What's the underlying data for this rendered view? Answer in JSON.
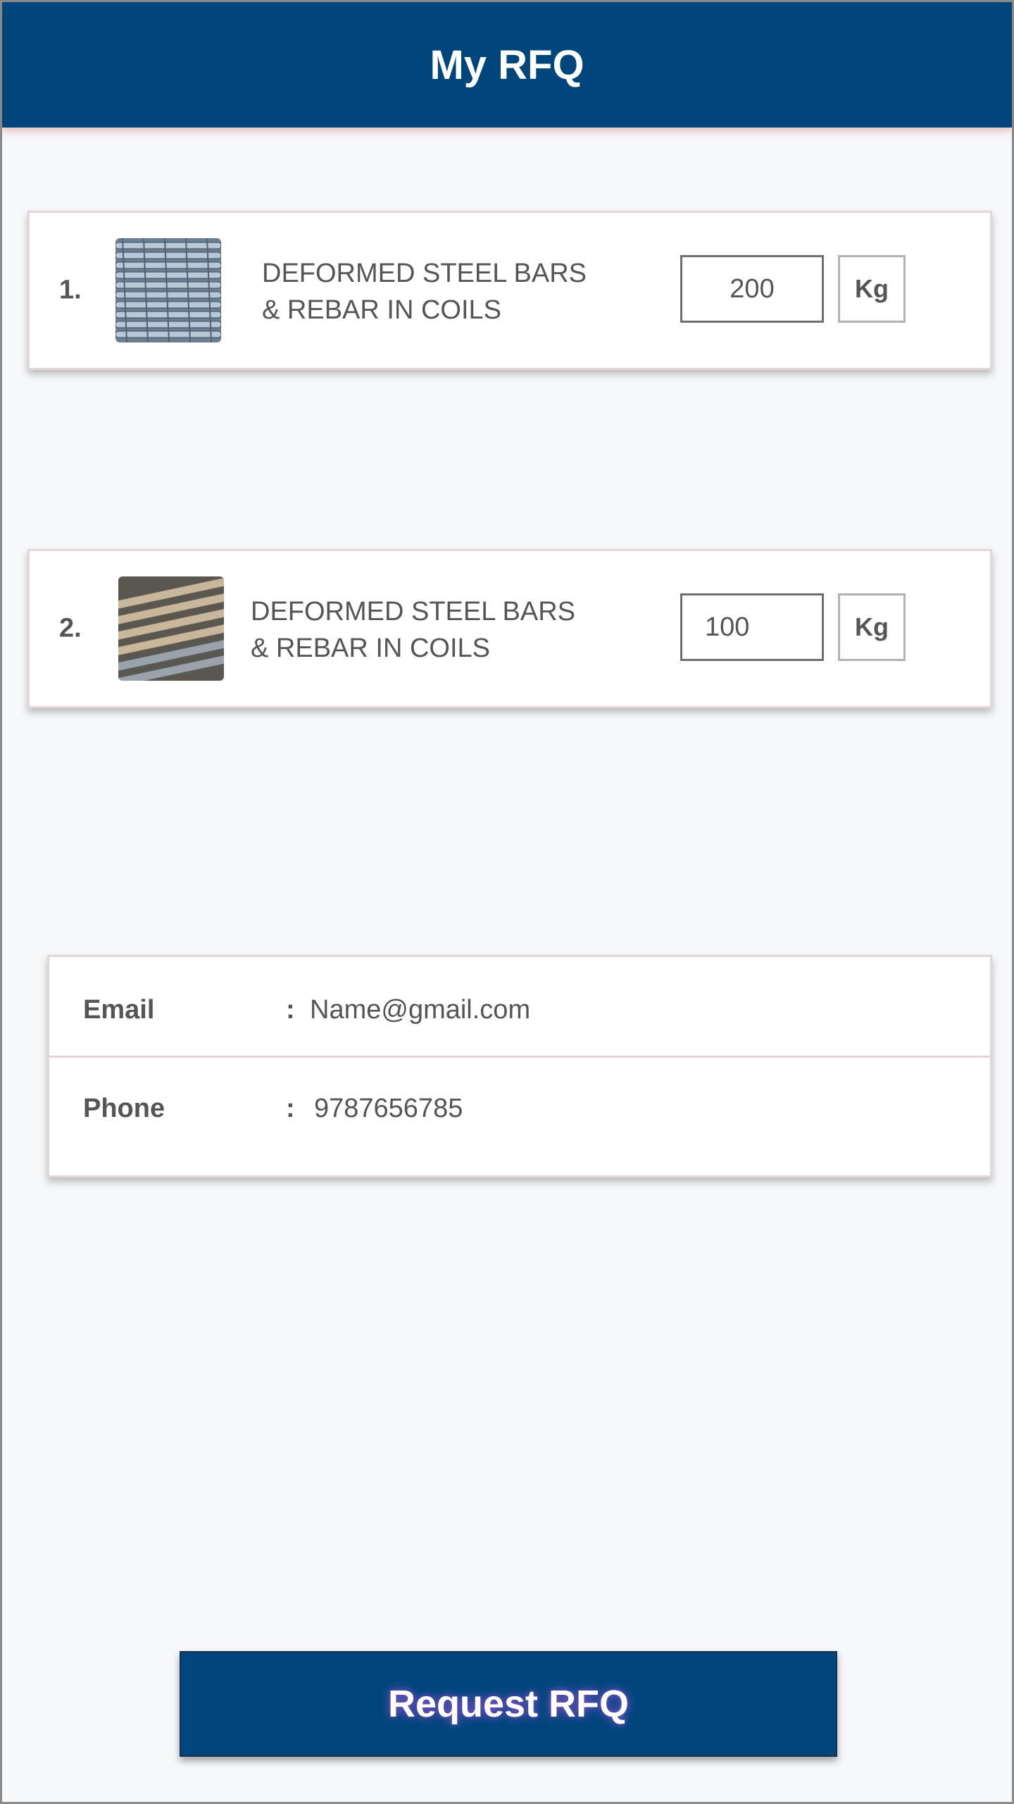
{
  "header": {
    "title": "My RFQ"
  },
  "items": [
    {
      "index": "1.",
      "name_line1": "DEFORMED STEEL BARS",
      "name_line2": "& REBAR IN COILS",
      "quantity": "200",
      "unit": "Kg"
    },
    {
      "index": "2.",
      "name_line1": "DEFORMED STEEL BARS",
      "name_line2": "& REBAR IN COILS",
      "quantity": "100",
      "unit": "Kg"
    }
  ],
  "contact": {
    "email_label": "Email",
    "email_value": "Name@gmail.com",
    "phone_label": "Phone",
    "phone_value": "9787656785",
    "separator": ":"
  },
  "cta": {
    "label": "Request RFQ"
  },
  "colors": {
    "primary": "#00457c",
    "background": "#f7f8fa",
    "text": "#555555"
  }
}
